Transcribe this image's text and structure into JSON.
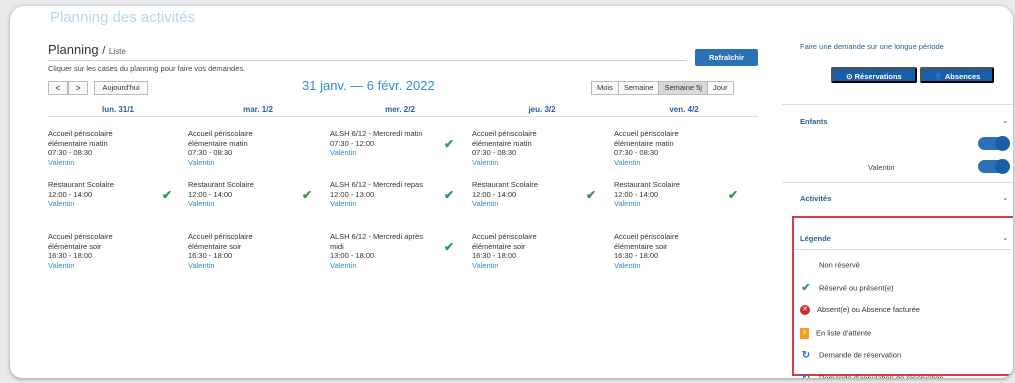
{
  "page": {
    "heading": "Planning des activités"
  },
  "planning": {
    "title": "Planning",
    "separator": "/",
    "subtitle": "Liste",
    "refresh_label": "Rafraîchir",
    "hint": "Cliquer sur les cases du planning pour faire vos demandes.",
    "prev_label": "<",
    "next_label": ">",
    "today_label": "Aujourd'hui",
    "range": "31 janv. — 6 févr. 2022",
    "views": [
      "Mois",
      "Semaine",
      "Semaine 5j",
      "Jour"
    ],
    "active_view": "Semaine 5j",
    "days": [
      {
        "label": "lun. 31/1",
        "slots": [
          {
            "activity": "Accueil périscolaire élémentaire matin",
            "time": "07:30 - 08:30",
            "child": "Valentin",
            "checked": false
          },
          {
            "activity": "Restaurant Scolaire",
            "time": "12:00 - 14:00",
            "child": "Valentin",
            "checked": true
          },
          {
            "activity": "Accueil périscolaire élémentaire soir",
            "time": "16:30 - 18:00",
            "child": "Valentin",
            "checked": false
          }
        ]
      },
      {
        "label": "mar. 1/2",
        "slots": [
          {
            "activity": "Accueil périscolaire élémentaire matin",
            "time": "07:30 - 08:30",
            "child": "Valentin",
            "checked": false
          },
          {
            "activity": "Restaurant Scolaire",
            "time": "12:00 - 14:00",
            "child": "Valentin",
            "checked": true
          },
          {
            "activity": "Accueil périscolaire élémentaire soir",
            "time": "16:30 - 18:00",
            "child": "Valentin",
            "checked": false
          }
        ]
      },
      {
        "label": "mer. 2/2",
        "slots": [
          {
            "activity": "ALSH 6/12 - Mercredi matin",
            "time": "07:30 - 12:00",
            "child": "Valentin",
            "checked": true
          },
          {
            "activity": "ALSH 6/12 - Mercredi repas",
            "time": "12:00 - 13:00",
            "child": "Valentin",
            "checked": true
          },
          {
            "activity": "ALSH 6/12 - Mercredi après midi",
            "time": "13:00 - 18:00",
            "child": "Valentin",
            "checked": true
          }
        ]
      },
      {
        "label": "jeu. 3/2",
        "slots": [
          {
            "activity": "Accueil périscolaire élémentaire matin",
            "time": "07:30 - 08:30",
            "child": "Valentin",
            "checked": false
          },
          {
            "activity": "Restaurant Scolaire",
            "time": "12:00 - 14:00",
            "child": "Valentin",
            "checked": true
          },
          {
            "activity": "Accueil périscolaire élémentaire soir",
            "time": "16:30 - 18:00",
            "child": "Valentin",
            "checked": false
          }
        ]
      },
      {
        "label": "ven. 4/2",
        "slots": [
          {
            "activity": "Accueil périscolaire élémentaire matin",
            "time": "07:30 - 08:30",
            "child": "Valentin",
            "checked": false
          },
          {
            "activity": "Restaurant Scolaire",
            "time": "12:00 - 14:00",
            "child": "Valentin",
            "checked": true
          },
          {
            "activity": "Accueil périscolaire élémentaire soir",
            "time": "16:30 - 18:00",
            "child": "Valentin",
            "checked": false
          }
        ]
      }
    ]
  },
  "sidebar": {
    "request_title": "Faire une demande sur une longue période",
    "reservations_label": "Réservations",
    "absences_label": "Absences",
    "children_title": "Enfants",
    "child_name": "Valentin",
    "activities_title": "Activités",
    "legend_title": "Légende",
    "legend": [
      {
        "icon": "none",
        "label": "Non réservé"
      },
      {
        "icon": "check-icon",
        "label": "Réservé ou présent(e)"
      },
      {
        "icon": "absent-icon",
        "label": "Absent(e) ou Absence facturée"
      },
      {
        "icon": "waiting-list-icon",
        "label": "En liste d'attente"
      },
      {
        "icon": "reservation-request-icon",
        "label": "Demande de réservation"
      },
      {
        "icon": "cancellation-request-icon",
        "label": "Demande d'annulation de réservation"
      }
    ]
  },
  "colors": {
    "accent": "#2e8fc9",
    "button": "#2a71b5",
    "check": "#2e9a54",
    "legend_border": "#d83a4e"
  }
}
